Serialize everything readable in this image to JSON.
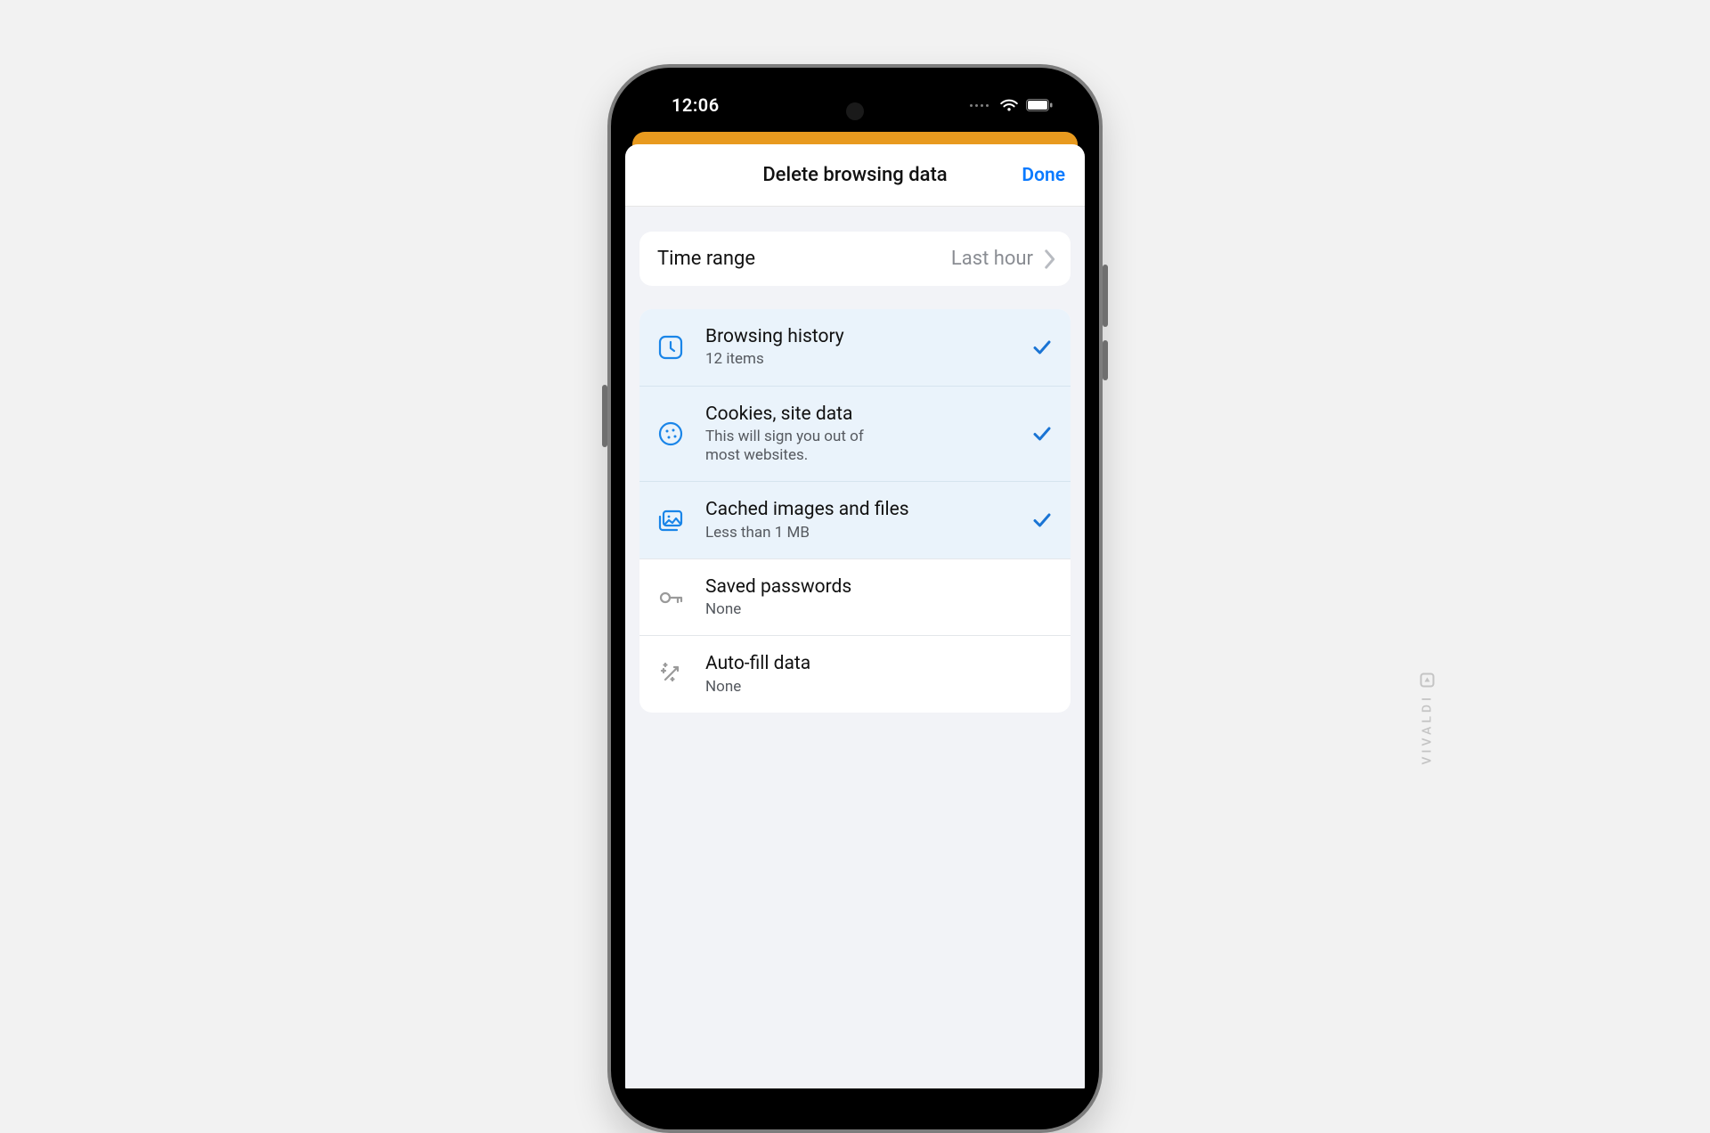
{
  "status": {
    "time": "12:06"
  },
  "sheet": {
    "title": "Delete browsing data",
    "done": "Done"
  },
  "time_range": {
    "label": "Time range",
    "value": "Last hour"
  },
  "items": [
    {
      "title": "Browsing history",
      "sub": "12 items",
      "selected": true,
      "icon": "clock"
    },
    {
      "title": "Cookies, site data",
      "sub": "This will sign you out of most websites.",
      "selected": true,
      "icon": "cookie"
    },
    {
      "title": "Cached images and files",
      "sub": "Less than 1 MB",
      "selected": true,
      "icon": "images"
    },
    {
      "title": "Saved passwords",
      "sub": "None",
      "selected": false,
      "icon": "key"
    },
    {
      "title": "Auto-fill data",
      "sub": "None",
      "selected": false,
      "icon": "wand"
    }
  ],
  "watermark": "VIVALDI",
  "colors": {
    "accent_link": "#0a7aff",
    "accent_icon": "#1a85e8",
    "selected_bg": "#eaf3fb",
    "orange": "#e89a1f"
  }
}
